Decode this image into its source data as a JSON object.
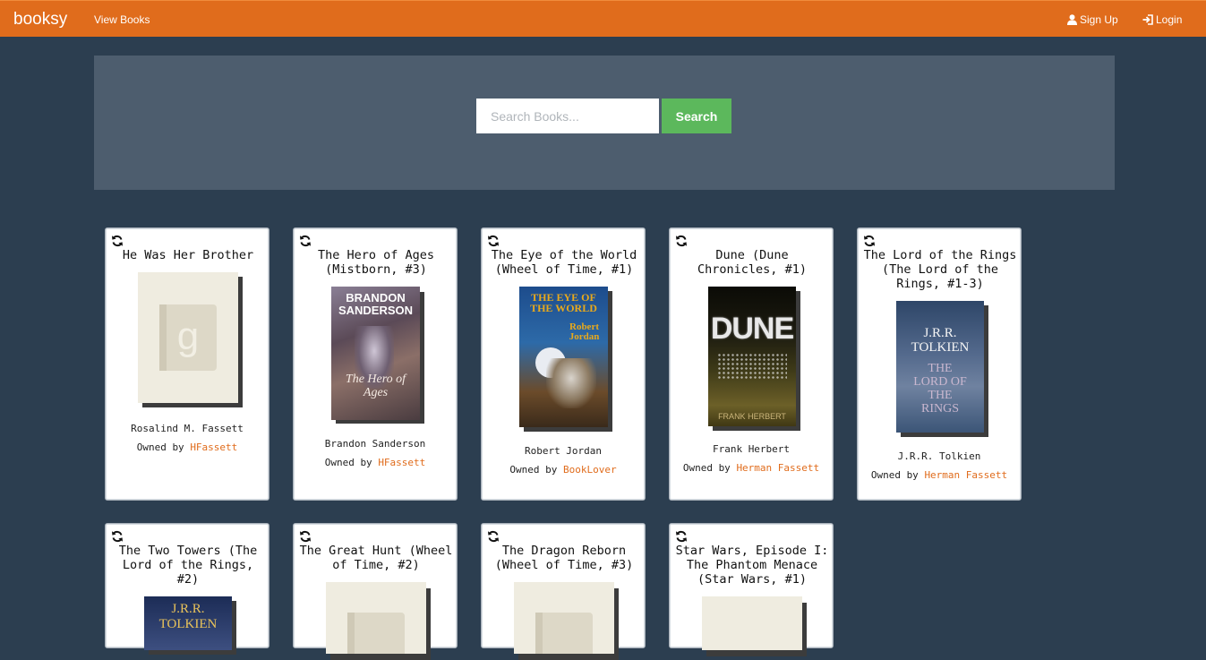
{
  "navbar": {
    "brand": "booksy",
    "view_books": "View Books",
    "sign_up": "Sign Up",
    "login": "Login"
  },
  "search": {
    "placeholder": "Search Books...",
    "button_label": "Search"
  },
  "books": [
    {
      "title": "He Was Her Brother",
      "author": "Rosalind M. Fassett",
      "owned_by_label": "Owned by",
      "owner": "HFassett",
      "cover": "goodreads-placeholder"
    },
    {
      "title": "The Hero of Ages (Mistborn, #3)",
      "author": "Brandon Sanderson",
      "owned_by_label": "Owned by",
      "owner": "HFassett",
      "cover": "hero-of-ages-cover",
      "cover_text": {
        "author": "BRANDON SANDERSON",
        "title": "The Hero of Ages"
      }
    },
    {
      "title": "The Eye of the World (Wheel of Time, #1)",
      "author": "Robert Jordan",
      "owned_by_label": "Owned by",
      "owner": "BookLover",
      "cover": "eye-of-the-world-cover",
      "cover_text": {
        "title": "THE EYE OF THE WORLD",
        "author": "Robert Jordan"
      }
    },
    {
      "title": "Dune (Dune Chronicles, #1)",
      "author": "Frank Herbert",
      "owned_by_label": "Owned by",
      "owner": "Herman Fassett",
      "cover": "dune-cover",
      "cover_text": {
        "title": "DUNE",
        "author": "FRANK HERBERT"
      }
    },
    {
      "title": "The Lord of the Rings (The Lord of the Rings, #1-3)",
      "author": "J.R.R. Tolkien",
      "owned_by_label": "Owned by",
      "owner": "Herman Fassett",
      "cover": "lord-of-the-rings-cover",
      "cover_text": {
        "author": "J.R.R. TOLKIEN",
        "title": "THE LORD OF THE RINGS"
      }
    },
    {
      "title": "The Two Towers (The Lord of the Rings, #2)",
      "cover": "two-towers-cover",
      "cover_text": {
        "author": "J.R.R. TOLKIEN"
      }
    },
    {
      "title": "The Great Hunt (Wheel of Time, #2)",
      "cover": "goodreads-placeholder"
    },
    {
      "title": "The Dragon Reborn (Wheel of Time, #3)",
      "cover": "goodreads-placeholder"
    },
    {
      "title": "Star Wars, Episode I: The Phantom Menace (Star Wars, #1)",
      "cover": "goodreads-placeholder"
    }
  ],
  "colors": {
    "navbar": "#e06c1c",
    "background": "#2c3e50",
    "jumbotron": "#4d5d6e",
    "search_button": "#5cb85c",
    "owner_link": "#e06c1c"
  },
  "icons": {
    "swap": "refresh-icon",
    "user": "user-icon",
    "login": "login-icon"
  }
}
